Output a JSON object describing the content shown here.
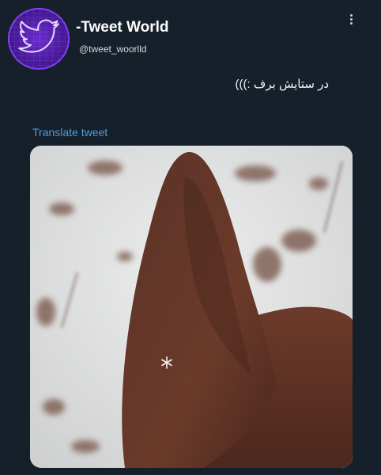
{
  "profile": {
    "display_name": "-Tweet World",
    "handle": "@tweet_woorlld",
    "avatar_icon": "twitter-bird-icon"
  },
  "tweet": {
    "text": "در ستایش برف :)))",
    "translate_label": "Translate tweet",
    "media_description_icon": "photo"
  },
  "menu": {
    "more_icon": "more-vertical-icon"
  },
  "colors": {
    "background": "#16202b",
    "link": "#4f9ad6",
    "avatar_purple": "#6d2bd0"
  }
}
